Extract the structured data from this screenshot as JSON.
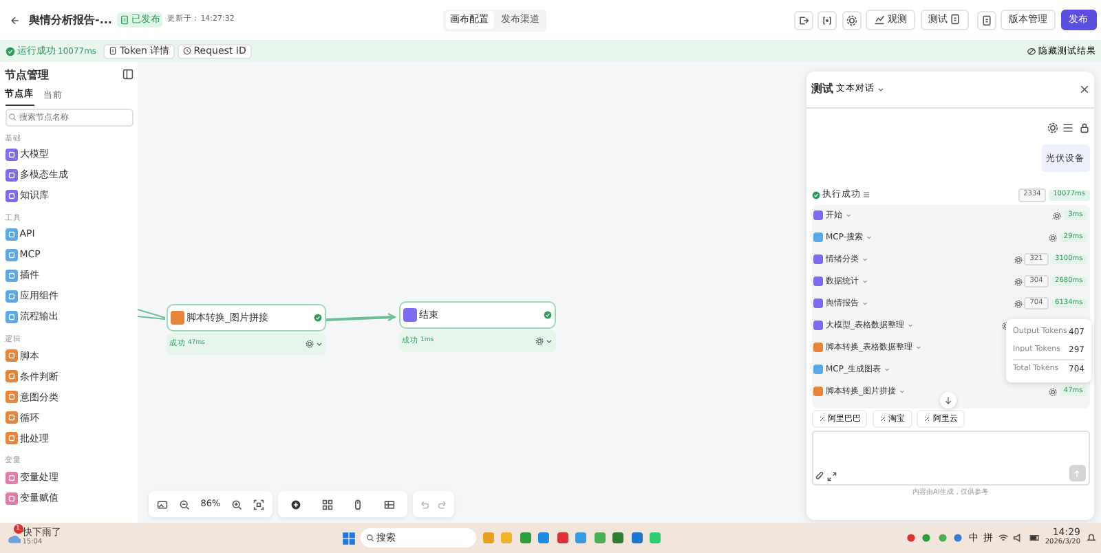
{
  "header": {
    "title": "舆情分析报告-...",
    "status": "已发布",
    "updated": "更新于：14:27:32",
    "tabs": [
      {
        "label": "画布配置",
        "selected": true
      },
      {
        "label": "发布渠道",
        "selected": false
      }
    ],
    "observe": "观测",
    "test": "测试",
    "versions": "版本管理",
    "publish": "发布"
  },
  "run_bar": {
    "status": "运行成功",
    "duration": "10077ms",
    "token_button": "Token 详情",
    "request_button": "Request ID",
    "hide": "隐藏测试结果"
  },
  "sidebar": {
    "title": "节点管理",
    "tabs": [
      {
        "label": "节点库",
        "selected": true
      },
      {
        "label": "当前",
        "selected": false
      }
    ],
    "search": {
      "placeholder": "搜索节点名称"
    },
    "groups": [
      {
        "title": "基础",
        "items": [
          {
            "label": "大模型",
            "color": "#7c6cf0"
          },
          {
            "label": "多模态生成",
            "color": "#7c6cf0"
          },
          {
            "label": "知识库",
            "color": "#7c6cf0"
          }
        ]
      },
      {
        "title": "工具",
        "items": [
          {
            "label": "API",
            "color": "#5aa8e8"
          },
          {
            "label": "MCP",
            "color": "#5aa8e8"
          },
          {
            "label": "插件",
            "color": "#5aa8e8"
          },
          {
            "label": "应用组件",
            "color": "#5aa8e8"
          },
          {
            "label": "流程输出",
            "color": "#5aa8e8"
          }
        ]
      },
      {
        "title": "逻辑",
        "items": [
          {
            "label": "脚本",
            "color": "#e8843a"
          },
          {
            "label": "条件判断",
            "color": "#e8843a"
          },
          {
            "label": "意图分类",
            "color": "#e8843a"
          },
          {
            "label": "循环",
            "color": "#e8843a"
          },
          {
            "label": "批处理",
            "color": "#e8843a"
          }
        ]
      },
      {
        "title": "变量",
        "items": [
          {
            "label": "变量处理",
            "color": "#e27aa9"
          },
          {
            "label": "变量赋值",
            "color": "#e27aa9"
          }
        ]
      }
    ]
  },
  "canvas": {
    "nodes": [
      {
        "title": "脚本转换_图片拼接",
        "color": "#e8843a",
        "status": "成功",
        "time": "47ms"
      },
      {
        "title": "结束",
        "color": "#7c6cf0",
        "status": "成功",
        "time": "1ms"
      }
    ],
    "zoom": "86%"
  },
  "test_panel": {
    "title": "测试",
    "mode": "文本对话",
    "user_message": "光伏设备",
    "exec_status": "执行成功",
    "tokens": "2334",
    "duration": "10077ms",
    "steps": [
      {
        "name": "开始",
        "color": "#7c6cf0",
        "duration": "3ms"
      },
      {
        "name": "MCP-搜索",
        "color": "#5aa8e8",
        "duration": "29ms"
      },
      {
        "name": "情绪分类",
        "color": "#7c6cf0",
        "tokens": "321",
        "duration": "3100ms"
      },
      {
        "name": "数据统计",
        "color": "#7c6cf0",
        "tokens": "304",
        "duration": "2680ms"
      },
      {
        "name": "舆情报告",
        "color": "#7c6cf0",
        "tokens": "704",
        "duration": "6134ms"
      },
      {
        "name": "大模型_表格数据整理",
        "color": "#7c6cf0"
      },
      {
        "name": "脚本转换_表格数据整理",
        "color": "#e8843a"
      },
      {
        "name": "MCP_生成图表",
        "color": "#5aa8e8"
      },
      {
        "name": "脚本转换_图片拼接",
        "color": "#e8843a",
        "duration": "47ms"
      }
    ],
    "token_tooltip": [
      {
        "label": "Output Tokens",
        "value": "407"
      },
      {
        "label": "Input Tokens",
        "value": "297"
      },
      {
        "label": "Total Tokens",
        "value": "704"
      }
    ],
    "suggestions": [
      "阿里巴巴",
      "淘宝",
      "阿里云"
    ],
    "footer": "内容由AI生成，仅供参考"
  },
  "taskbar": {
    "weather": "快下雨了",
    "weather_time": "15:04",
    "badge": "1",
    "search": "搜索",
    "ime": "中",
    "ime_mode": "拼",
    "time": "14:29",
    "date": "2026/3/20"
  }
}
